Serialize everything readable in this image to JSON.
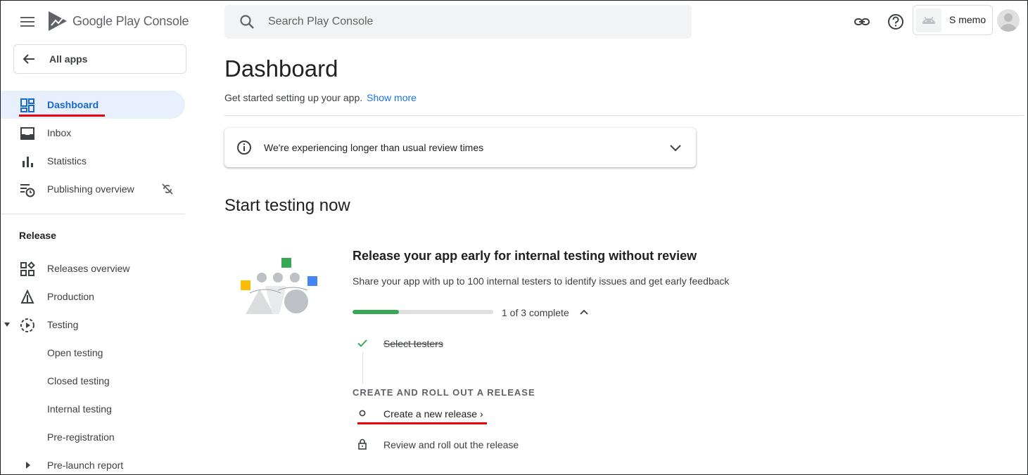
{
  "brand": {
    "name": "Google Play",
    "product": "Console"
  },
  "sidebar": {
    "all_apps": "All apps",
    "primary": [
      {
        "label": "Dashboard",
        "icon": "dashboard-icon",
        "active": true
      },
      {
        "label": "Inbox",
        "icon": "inbox-icon"
      },
      {
        "label": "Statistics",
        "icon": "bar-chart-icon"
      },
      {
        "label": "Publishing overview",
        "icon": "publishing-icon"
      }
    ],
    "section_label": "Release",
    "release": [
      {
        "label": "Releases overview",
        "icon": "releases-overview-icon"
      },
      {
        "label": "Production",
        "icon": "production-icon"
      },
      {
        "label": "Testing",
        "icon": "testing-icon"
      }
    ],
    "testing_sub": [
      "Open testing",
      "Closed testing",
      "Internal testing",
      "Pre-registration",
      "Pre-launch report"
    ]
  },
  "search": {
    "placeholder": "Search Play Console"
  },
  "account": {
    "name": "S memo"
  },
  "main": {
    "title": "Dashboard",
    "subtitle": "Get started setting up your app.",
    "show_more": "Show more",
    "banner": "We're experiencing longer than usual review times",
    "section_title": "Start testing now",
    "card": {
      "title": "Release your app early for internal testing without review",
      "desc": "Share your app with up to 100 internal testers to identify issues and get early feedback",
      "progress": 0.33,
      "progress_text": "1 of 3 complete",
      "step_done": "Select testers",
      "step_heading": "CREATE AND ROLL OUT A RELEASE",
      "step_action": "Create a new release",
      "step_locked": "Review and roll out the release"
    }
  },
  "colors": {
    "accent": "#1a73e8",
    "active_bg": "#e8f0fe",
    "progress": "#34a853",
    "highlight": "#e8000b"
  }
}
